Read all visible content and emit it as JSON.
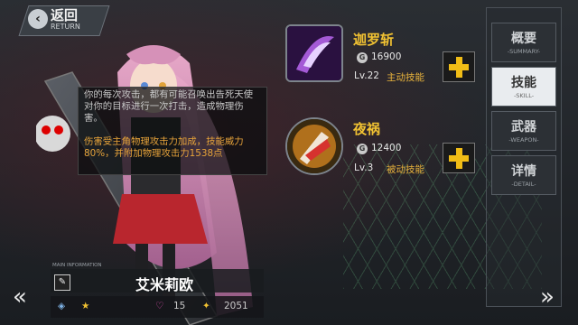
{
  "back": {
    "label_cn": "返回",
    "label_en": "RETURN"
  },
  "description": {
    "text": "你的每次攻击，都有可能召唤出告死天使对你的目标进行一次打击，造成物理伤害。",
    "highlight": "伤害受主角物理攻击力加成，技能威力80%，并附加物理攻击力1538点"
  },
  "skills": [
    {
      "name": "迦罗斩",
      "cost": "16900",
      "level": "Lv.22",
      "type": "主动技能",
      "icon": "dark-slash-skill-icon"
    },
    {
      "name": "夜祸",
      "cost": "12400",
      "level": "Lv.3",
      "type": "被动技能",
      "icon": "night-calamity-skill-icon"
    }
  ],
  "tabs": [
    {
      "cn": "概要",
      "en": "-SUMMARY-",
      "active": false
    },
    {
      "cn": "技能",
      "en": "-SKILL-",
      "active": true
    },
    {
      "cn": "武器",
      "en": "-WEAPON-",
      "active": false
    },
    {
      "cn": "详情",
      "en": "-DETAIL-",
      "active": false
    }
  ],
  "character": {
    "info_label": "MAIN INFORMATION",
    "name": "艾米莉欧",
    "hearts": "15",
    "power": "2051"
  },
  "colors": {
    "accent": "#f1bd16",
    "skill_name": "#f1c232",
    "highlight": "#e8a43a"
  }
}
